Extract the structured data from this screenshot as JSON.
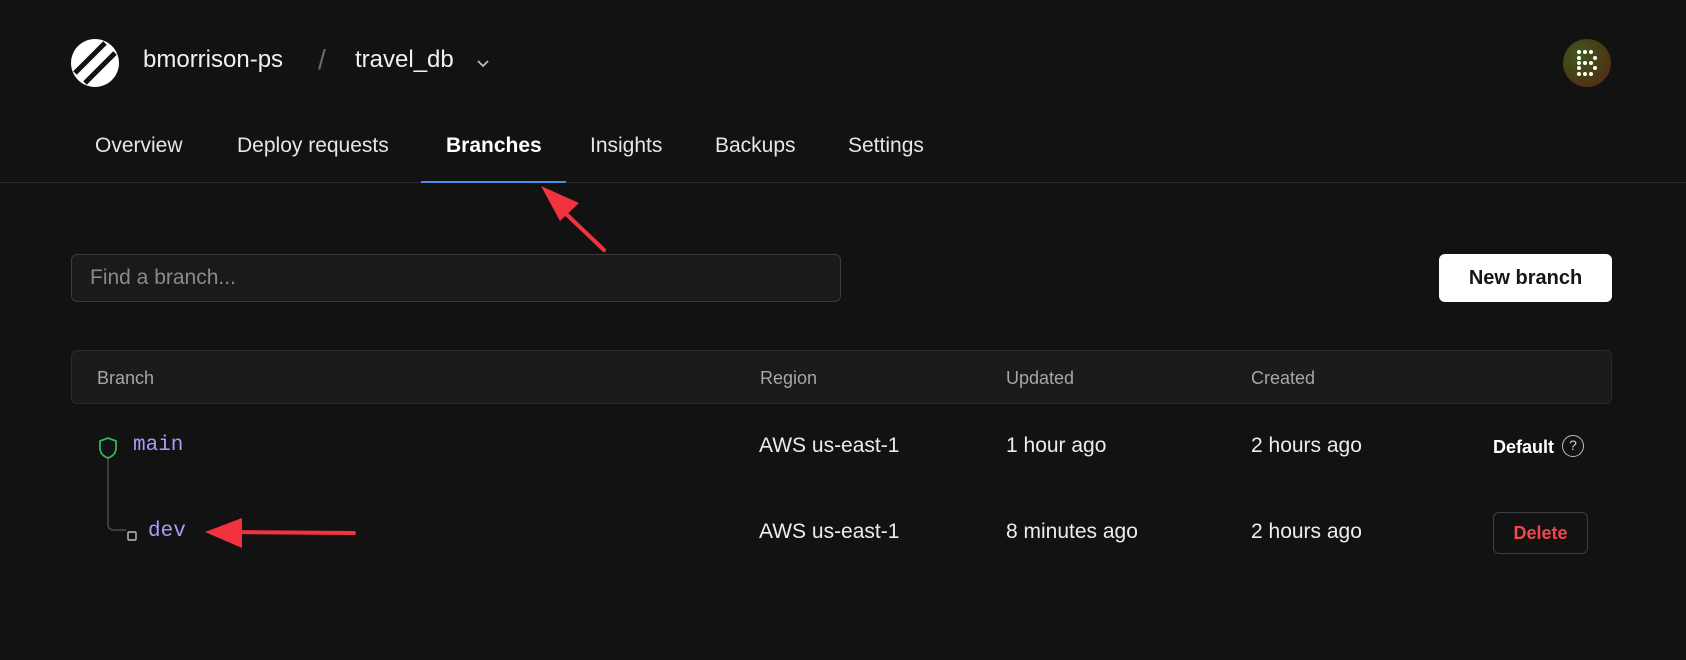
{
  "header": {
    "org": "bmorrison-ps",
    "separator": "/",
    "database": "travel_db",
    "avatar_letter": "B"
  },
  "nav": {
    "tabs": [
      {
        "label": "Overview"
      },
      {
        "label": "Deploy requests"
      },
      {
        "label": "Branches",
        "active": true
      },
      {
        "label": "Insights"
      },
      {
        "label": "Backups"
      },
      {
        "label": "Settings"
      }
    ]
  },
  "search": {
    "placeholder": "Find a branch..."
  },
  "toolbar": {
    "new_branch_label": "New branch"
  },
  "table": {
    "headers": [
      "Branch",
      "Region",
      "Updated",
      "Created"
    ],
    "rows": [
      {
        "branch": "main",
        "region": "AWS us-east-1",
        "updated": "1 hour ago",
        "created": "2 hours ago",
        "action": "Default",
        "icon": "shield-icon"
      },
      {
        "branch": "dev",
        "region": "AWS us-east-1",
        "updated": "8 minutes ago",
        "created": "2 hours ago",
        "action": "Delete",
        "icon": "branch-node-icon"
      }
    ]
  },
  "help_glyph": "?",
  "colors": {
    "background": "#121212",
    "branch_name": "#a99af7",
    "shield": "#2fb557",
    "delete": "#f0474a",
    "annotation_arrow": "#f2333e",
    "active_tab_underline": "#4a8bf0"
  }
}
